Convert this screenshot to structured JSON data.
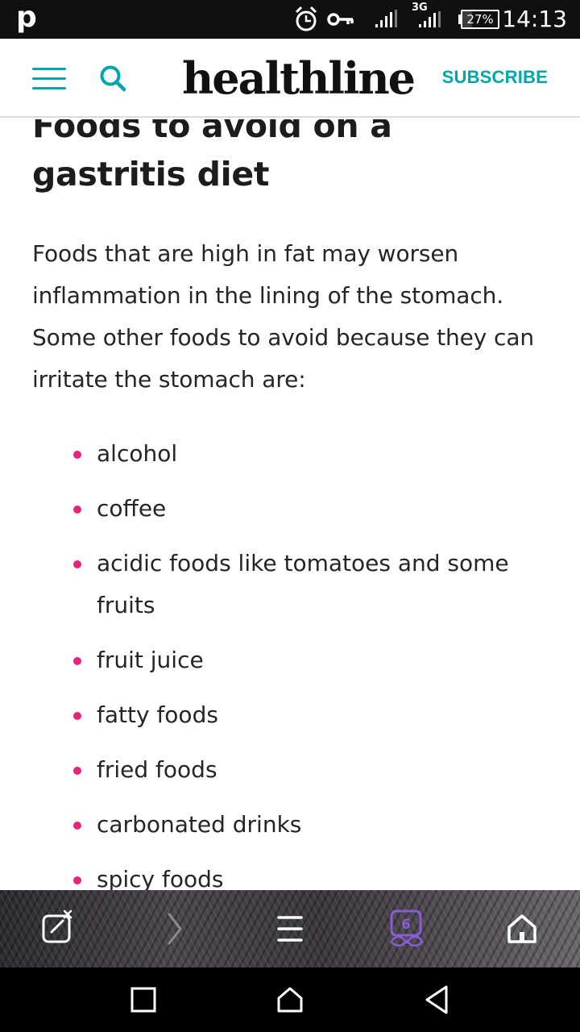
{
  "status_bar": {
    "app_letter": "p",
    "network_type": "3G",
    "battery_percent": "27%",
    "time": "14:13",
    "icons": [
      "alarm-clock-icon",
      "key-icon",
      "signal-icon",
      "signal-3g-icon",
      "battery-icon"
    ]
  },
  "header": {
    "logo": "healthline",
    "subscribe_label": "SUBSCRIBE",
    "icons": [
      "hamburger-menu-icon",
      "search-icon"
    ],
    "accent_color": "#00a6a9"
  },
  "article": {
    "heading": "Foods to avoid on a gastritis diet",
    "intro": "Foods that are high in fat may worsen inflammation in the lining of the stomach. Some other foods to avoid because they can irritate the stomach are:",
    "bullet_color": "#e4247a",
    "foods": [
      "alcohol",
      "coffee",
      "acidic foods like tomatoes and some fruits",
      "fruit juice",
      "fatty foods",
      "fried foods",
      "carbonated drinks",
      "spicy foods"
    ]
  },
  "browser_toolbar": {
    "tab_count": "6",
    "icons": [
      "close-tab-icon",
      "forward-arrow-icon",
      "menu-icon",
      "incognito-mask-icon",
      "home-icon"
    ]
  },
  "nav_bar": {
    "icons": [
      "recents-square-icon",
      "home-outline-icon",
      "back-triangle-icon"
    ]
  }
}
